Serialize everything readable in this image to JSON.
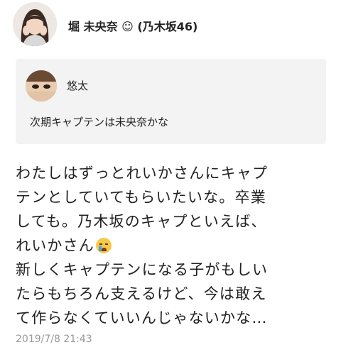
{
  "post": {
    "author_name": "堀 未央奈 ☺ (乃木坂46)",
    "quote": {
      "name": "悠太",
      "text": "次期キャプテンは未央奈かな"
    },
    "body_lines": [
      "わたしはずっとれいかさんにキャプ",
      "テンとしていてもらいたいな。卒業",
      "しても。乃木坂のキャプといえば、",
      "れいかさん",
      "新しくキャプテンになる子がもしい",
      "たらもちろん支えるけど、今は敢え",
      "て作らなくていいんじゃないかな…"
    ],
    "emoji_icon": "crying-face-icon",
    "timestamp": "2019/7/8 21:43"
  },
  "colors": {
    "quote_background": "#f3f3f3",
    "text": "#222222",
    "timestamp": "#999999"
  }
}
